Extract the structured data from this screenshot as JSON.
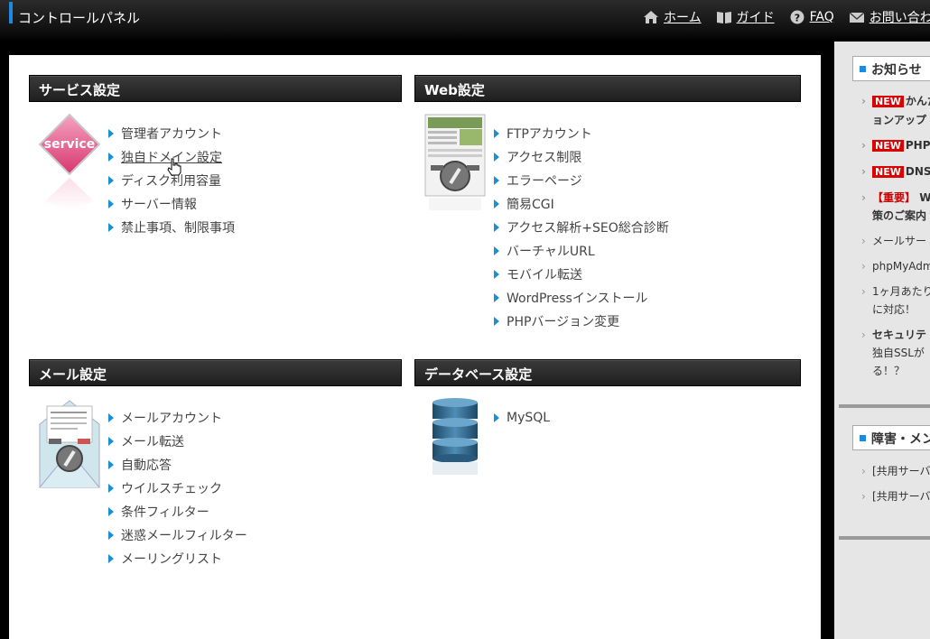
{
  "header": {
    "title": "コントロールパネル",
    "nav": [
      {
        "icon": "home-icon",
        "label": "ホーム"
      },
      {
        "icon": "book-icon",
        "label": "ガイド"
      },
      {
        "icon": "question-icon",
        "label": "FAQ"
      },
      {
        "icon": "mail-icon",
        "label": "お問い合わせ"
      }
    ]
  },
  "sections": {
    "service": {
      "title": "サービス設定",
      "items": [
        "管理者アカウント",
        "独自ドメイン設定",
        "ディスク利用容量",
        "サーバー情報",
        "禁止事項、制限事項"
      ],
      "thumb_label": "service"
    },
    "web": {
      "title": "Web設定",
      "items": [
        "FTPアカウント",
        "アクセス制限",
        "エラーページ",
        "簡易CGI",
        "アクセス解析+SEO総合診断",
        "バーチャルURL",
        "モバイル転送",
        "WordPressインストール",
        "PHPバージョン変更"
      ]
    },
    "mail": {
      "title": "メール設定",
      "items": [
        "メールアカウント",
        "メール転送",
        "自動応答",
        "ウイルスチェック",
        "条件フィルター",
        "迷惑メールフィルター",
        "メーリングリスト"
      ]
    },
    "db": {
      "title": "データベース設定",
      "items": [
        "MySQL"
      ]
    }
  },
  "sidebar": {
    "news_title": "お知らせ",
    "news": [
      {
        "badge": "NEW",
        "line1": "かんた",
        "line2": "ョンアップ"
      },
      {
        "badge": "NEW",
        "line1": "PHP"
      },
      {
        "badge": "NEW",
        "line1": "DNS"
      },
      {
        "tag": "【重要】",
        "line1": "W",
        "line2": "策のご案内"
      },
      {
        "line1": "メールサー"
      },
      {
        "line1": "phpMyAdm"
      },
      {
        "line1": "1ヶ月あたり",
        "line2": "に対応！"
      },
      {
        "line1": "セキュリテ",
        "line2": "独自SSLが",
        "line3": "る！？"
      }
    ],
    "outage_title": "障害・メン",
    "outage": [
      "[共用サーバ",
      "[共用サーバ"
    ],
    "accent_color": "#1e88e5"
  }
}
